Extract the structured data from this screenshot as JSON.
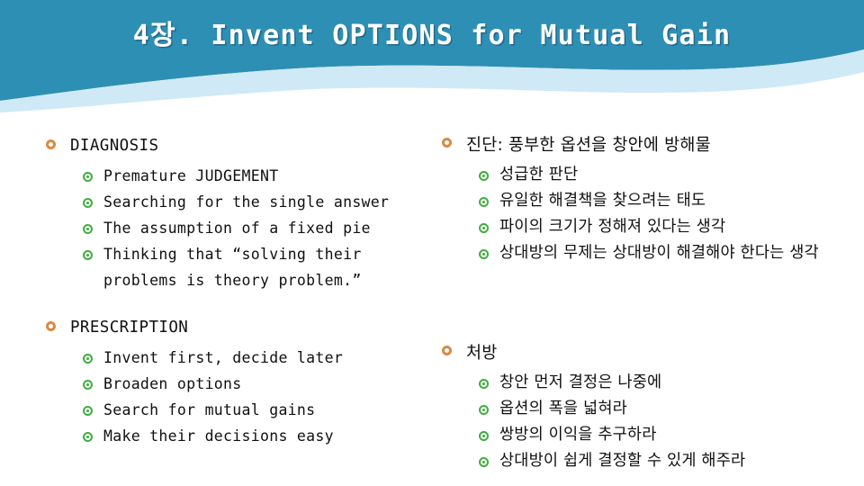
{
  "slide": {
    "title": "4장. Invent OPTIONS for Mutual Gain",
    "colors": {
      "banner": "#2e8fb5",
      "wave_light": "#cfe9f7",
      "title_text": "#ffffff",
      "bullet_level1": "#d98b42",
      "bullet_level2": "#3fae3f",
      "body_text": "#101010"
    }
  },
  "left_column": {
    "sections": [
      {
        "heading": "DIAGNOSIS",
        "items": [
          "Premature JUDGEMENT",
          "Searching for the single answer",
          "The assumption of a fixed pie",
          "Thinking that  “solving their problems is theory problem.”"
        ]
      },
      {
        "heading": "PRESCRIPTION",
        "items": [
          "Invent first, decide later",
          "Broaden options",
          "Search for mutual gains",
          "Make their decisions easy"
        ]
      }
    ]
  },
  "right_column": {
    "sections": [
      {
        "heading": "진단: 풍부한 옵션을 창안에 방해물",
        "items": [
          "성급한 판단",
          "유일한 해결책을 찾으려는 태도",
          "파이의 크기가 정해져 있다는 생각",
          "상대방의 무제는 상대방이 해결해야 한다는 생각"
        ]
      },
      {
        "heading": "처방",
        "items": [
          "창안 먼저 결정은 나중에",
          "옵션의 폭을 넓혀라",
          "쌍방의 이익을 추구하라",
          "상대방이 쉽게 결정할 수 있게 해주라"
        ]
      }
    ]
  }
}
